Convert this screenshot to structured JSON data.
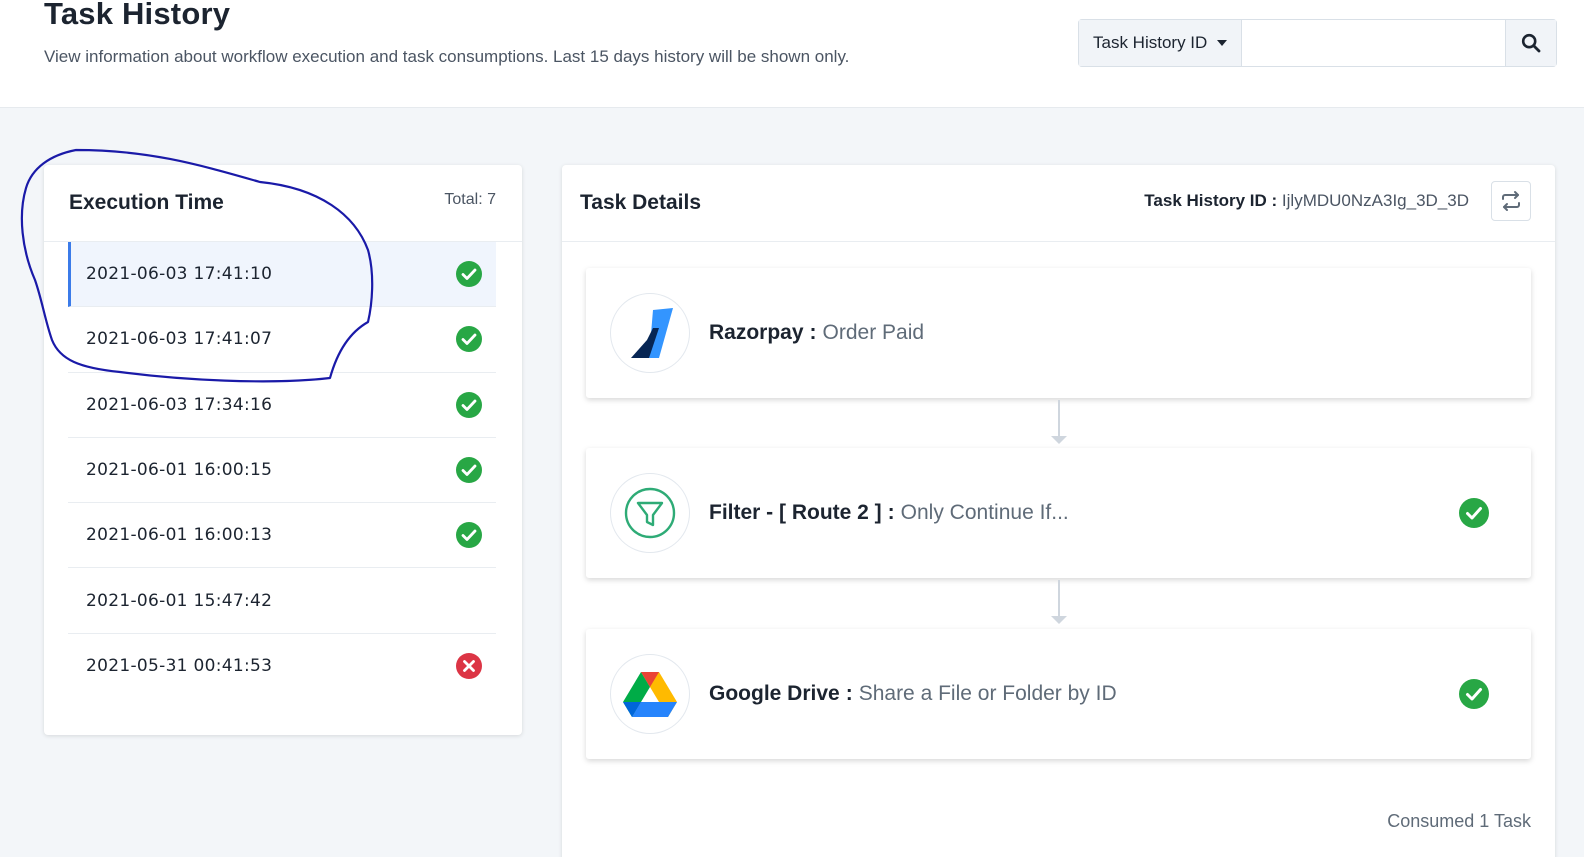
{
  "header": {
    "title": "Task History",
    "subtitle": "View information about workflow execution and task consumptions. Last 15 days history will be shown only."
  },
  "search": {
    "filter_label": "Task History ID",
    "value": "",
    "placeholder": ""
  },
  "executions": {
    "title": "Execution Time",
    "total": "Total: 7",
    "rows": [
      {
        "time": "2021-06-03 17:41:10",
        "status": "success",
        "selected": true
      },
      {
        "time": "2021-06-03 17:41:07",
        "status": "success"
      },
      {
        "time": "2021-06-03 17:34:16",
        "status": "success"
      },
      {
        "time": "2021-06-01 16:00:15",
        "status": "success"
      },
      {
        "time": "2021-06-01 16:00:13",
        "status": "success"
      },
      {
        "time": "2021-06-01 15:47:42",
        "status": "none"
      },
      {
        "time": "2021-05-31 00:41:53",
        "status": "error"
      }
    ]
  },
  "details": {
    "title": "Task Details",
    "id_label": "Task History ID :",
    "id_value": "IjlyMDU0NzA3Ig_3D_3D",
    "steps": [
      {
        "app": "Razorpay",
        "sep": ":",
        "action": "Order Paid",
        "icon": "razorpay-logo",
        "status": "none"
      },
      {
        "app": "Filter - [ Route 2 ]",
        "sep": ":",
        "action": "Only Continue If...",
        "icon": "filter-icon",
        "status": "success"
      },
      {
        "app": "Google Drive",
        "sep": ":",
        "action": "Share a File or Folder by ID",
        "icon": "google-drive-logo",
        "status": "success"
      }
    ],
    "consumed": "Consumed 1 Task"
  },
  "colors": {
    "success": "#28a745",
    "error": "#dc3545",
    "accent": "#3b7be9",
    "annotation": "#1a1aa8"
  }
}
